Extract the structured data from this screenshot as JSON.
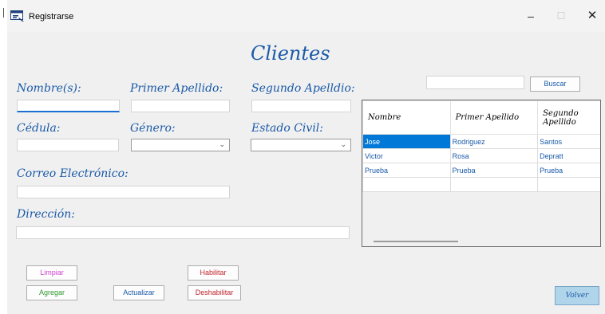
{
  "window": {
    "title": "Registrarse",
    "controls": {
      "minimize": "–",
      "maximize": "☐",
      "close": "✕"
    }
  },
  "form": {
    "heading": "Clientes",
    "labels": {
      "nombres": "Nombre(s):",
      "primer_apellido": "Primer Apellido:",
      "segundo_apellido": "Segundo Apelldio:",
      "cedula": "Cédula:",
      "genero": "Género:",
      "estado_civil": "Estado Civil:",
      "correo": "Correo Electrónico:",
      "direccion": "Dirección:"
    },
    "fields": {
      "nombres": "",
      "primer_apellido": "",
      "segundo_apellido": "",
      "cedula": "",
      "genero": "",
      "estado_civil": "",
      "correo": "",
      "direccion": ""
    }
  },
  "search": {
    "value": "",
    "button_label": "Buscar"
  },
  "table": {
    "headers": [
      "Nombre",
      "Primer Apellido",
      "Segundo Apellido"
    ],
    "rows": [
      [
        "Jose",
        "Rodriguez",
        "Santos"
      ],
      [
        "Victor",
        "Rosa",
        "Depratt"
      ],
      [
        "Prueba",
        "Prueba",
        "Prueba"
      ]
    ]
  },
  "buttons": {
    "limpiar": "Limpiar",
    "habilitar": "Habilitar",
    "agregar": "Agregar",
    "actualizar": "Actualizar",
    "deshabilitar": "Deshabilitar",
    "volver": "Volver"
  }
}
